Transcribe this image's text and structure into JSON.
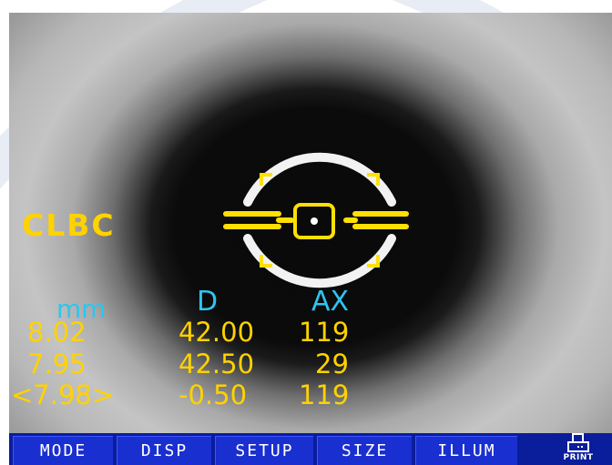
{
  "mode_label": "CLBC",
  "readout": {
    "headers": {
      "mm": "mm",
      "d": "D",
      "ax": "AX"
    },
    "rows": [
      {
        "mm": "8.02",
        "d": "42.00",
        "ax": "119"
      },
      {
        "mm": "7.95",
        "d": "42.50",
        "ax": "29"
      },
      {
        "mm": "<7.98>",
        "d": "-0.50",
        "ax": "119"
      }
    ]
  },
  "menu": {
    "buttons": [
      "MODE",
      "DISP",
      "SETUP",
      "SIZE",
      "ILLUM"
    ],
    "print_label": "PRINT",
    "print_icon": "printer-icon"
  },
  "colors": {
    "value_text": "#ffd200",
    "header_text": "#2ec5f0",
    "menu_bg": "#0a1d9a",
    "button_bg": "#1a2fd0"
  }
}
